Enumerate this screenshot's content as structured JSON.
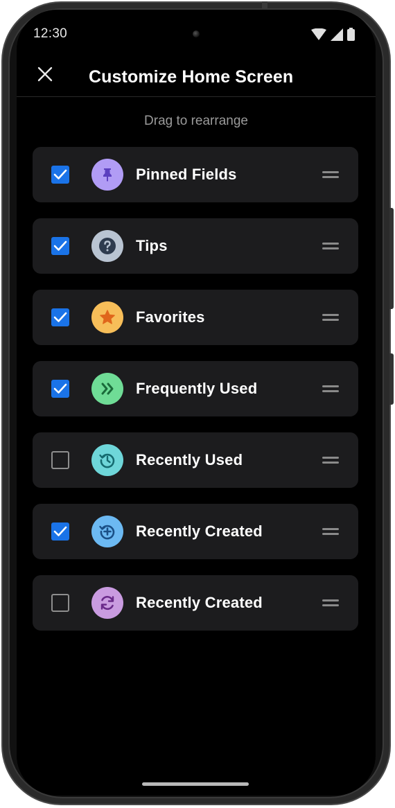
{
  "status_bar": {
    "time": "12:30",
    "icons": [
      "wifi-icon",
      "signal-icon",
      "battery-icon"
    ]
  },
  "app_bar": {
    "close_icon": "close-icon",
    "title": "Customize Home Screen"
  },
  "hint": "Drag to rearrange",
  "colors": {
    "background": "#000000",
    "card": "#1c1c1e",
    "checkbox_checked": "#1a73e8",
    "pinned": "#b19cf5",
    "tips": "#b9c4d2",
    "favorites": "#f7be59",
    "frequently_used": "#6fdc96",
    "recently_used": "#6ed6d9",
    "recently_created_1": "#6cb9f2",
    "recently_created_2": "#c99be0"
  },
  "items": [
    {
      "label": "Pinned Fields",
      "checked": true,
      "icon": "pin-icon",
      "icon_bg": "#b19cf5",
      "icon_fg": "#5b3fbf"
    },
    {
      "label": "Tips",
      "checked": true,
      "icon": "question-icon",
      "icon_bg": "#b9c4d2",
      "icon_fg": "#2e3b4e"
    },
    {
      "label": "Favorites",
      "checked": true,
      "icon": "star-icon",
      "icon_bg": "#f7be59",
      "icon_fg": "#e0661b"
    },
    {
      "label": "Frequently Used",
      "checked": true,
      "icon": "double-chevron-right-icon",
      "icon_bg": "#6fdc96",
      "icon_fg": "#1a6b3a"
    },
    {
      "label": "Recently Used",
      "checked": false,
      "icon": "history-icon",
      "icon_bg": "#6ed6d9",
      "icon_fg": "#156b70"
    },
    {
      "label": "Recently Created",
      "checked": true,
      "icon": "history-add-icon",
      "icon_bg": "#6cb9f2",
      "icon_fg": "#1a4f86"
    },
    {
      "label": "Recently Created",
      "checked": false,
      "icon": "sync-icon",
      "icon_bg": "#c99be0",
      "icon_fg": "#6a2a8a"
    }
  ]
}
